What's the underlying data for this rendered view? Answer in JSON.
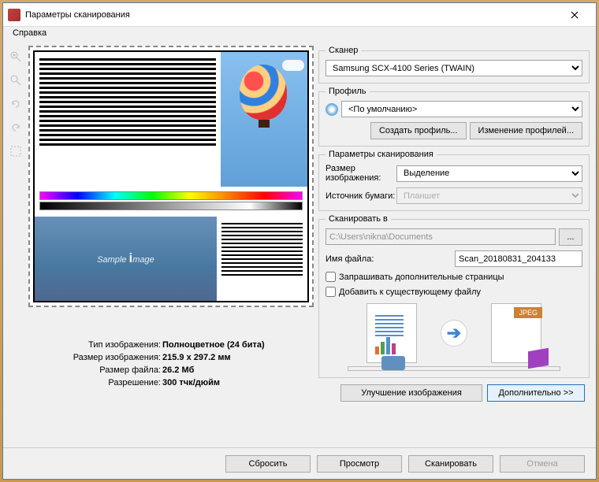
{
  "window": {
    "title": "Параметры сканирования"
  },
  "menu": {
    "help": "Справка"
  },
  "preview": {
    "sample_text": "Sample Image"
  },
  "info": {
    "type_label": "Тип изображения:",
    "type_value": "Полноцветное (24 бита)",
    "size_label": "Размер изображения:",
    "size_value": "215.9 x 297.2 мм",
    "filesize_label": "Размер файла:",
    "filesize_value": "26.2 Мб",
    "resolution_label": "Разрешение:",
    "resolution_value": "300 тчк/дюйм"
  },
  "scanner": {
    "legend": "Сканер",
    "value": "Samsung SCX-4100 Series (TWAIN)"
  },
  "profile": {
    "legend": "Профиль",
    "value": "<По умолчанию>",
    "create": "Создать профиль...",
    "edit": "Изменение профилей..."
  },
  "params": {
    "legend": "Параметры сканирования",
    "img_size_label": "Размер изображения:",
    "img_size_value": "Выделение",
    "source_label": "Источник бумаги:",
    "source_value": "Планшет"
  },
  "scan_to": {
    "legend": "Сканировать в",
    "path": "C:\\Users\\nikna\\Documents",
    "browse": "...",
    "filename_label": "Имя файла:",
    "filename_value": "Scan_20180831_204133",
    "ask_more": "Запрашивать дополнительные страницы",
    "append": "Добавить к существующему файлу"
  },
  "pipeline": {
    "jpeg_tag": "JPEG"
  },
  "actions": {
    "enhance": "Улучшение изображения",
    "advanced": "Дополнительно >>",
    "reset": "Сбросить",
    "preview": "Просмотр",
    "scan": "Сканировать",
    "cancel": "Отмена"
  }
}
